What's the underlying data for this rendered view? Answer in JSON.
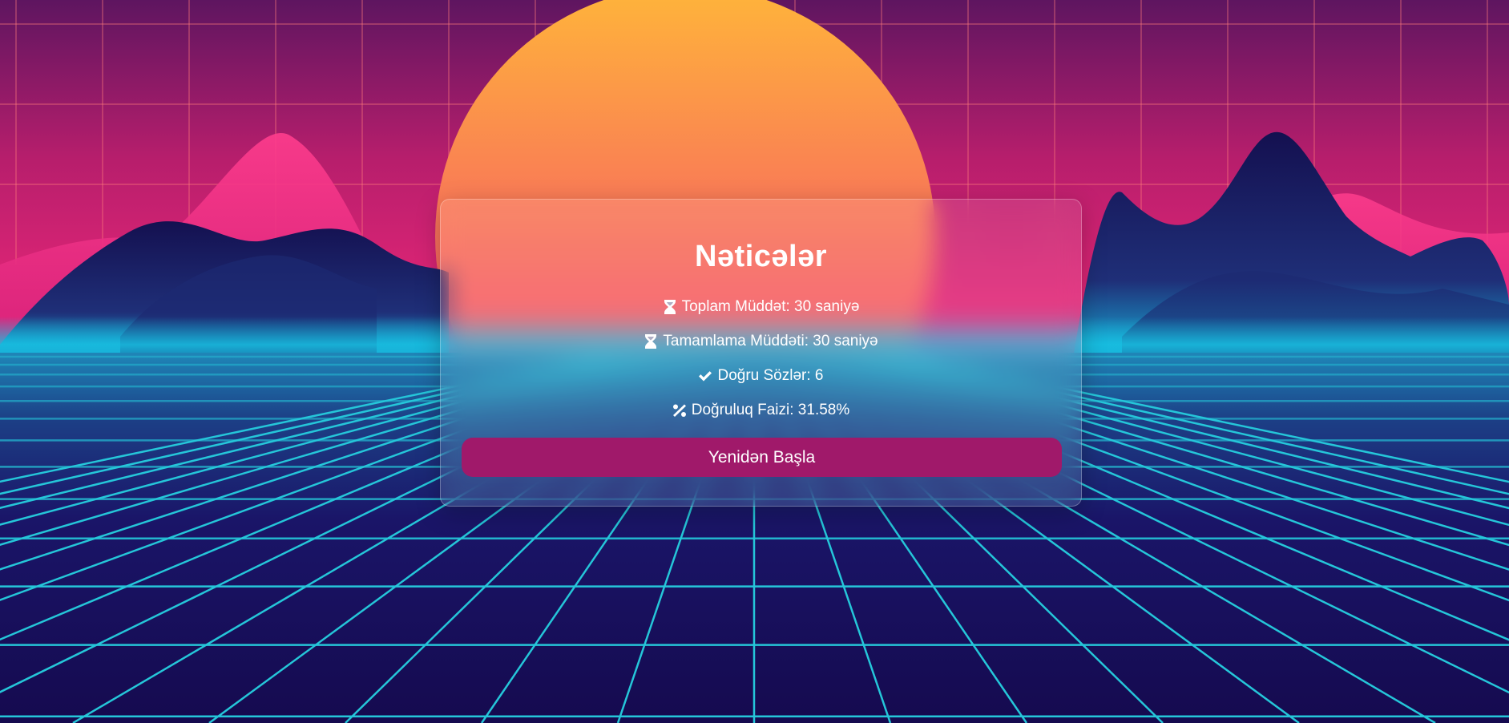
{
  "results": {
    "title": "Nəticələr",
    "stats": [
      {
        "icon": "hourglass-icon",
        "text": "Toplam Müddət: 30 saniyə"
      },
      {
        "icon": "hourglass-icon",
        "text": "Tamamlama Müddəti: 30 saniyə"
      },
      {
        "icon": "checkmark-icon",
        "text": "Doğru Sözlər: 6"
      },
      {
        "icon": "percent-icon",
        "text": "Doğruluq Faizi: 31.58%"
      }
    ],
    "restart_label": "Yenidən Başla"
  },
  "colors": {
    "sky_top": "#5e1560",
    "sky_pink": "#f0287a",
    "sun_top": "#ffb53a",
    "sun_bottom": "#f33082",
    "mountain": "#1b1657",
    "horizon_cyan": "#17c2e3",
    "floor": "#170b55",
    "grid": "#25c6d9",
    "button": "#a0196a"
  }
}
